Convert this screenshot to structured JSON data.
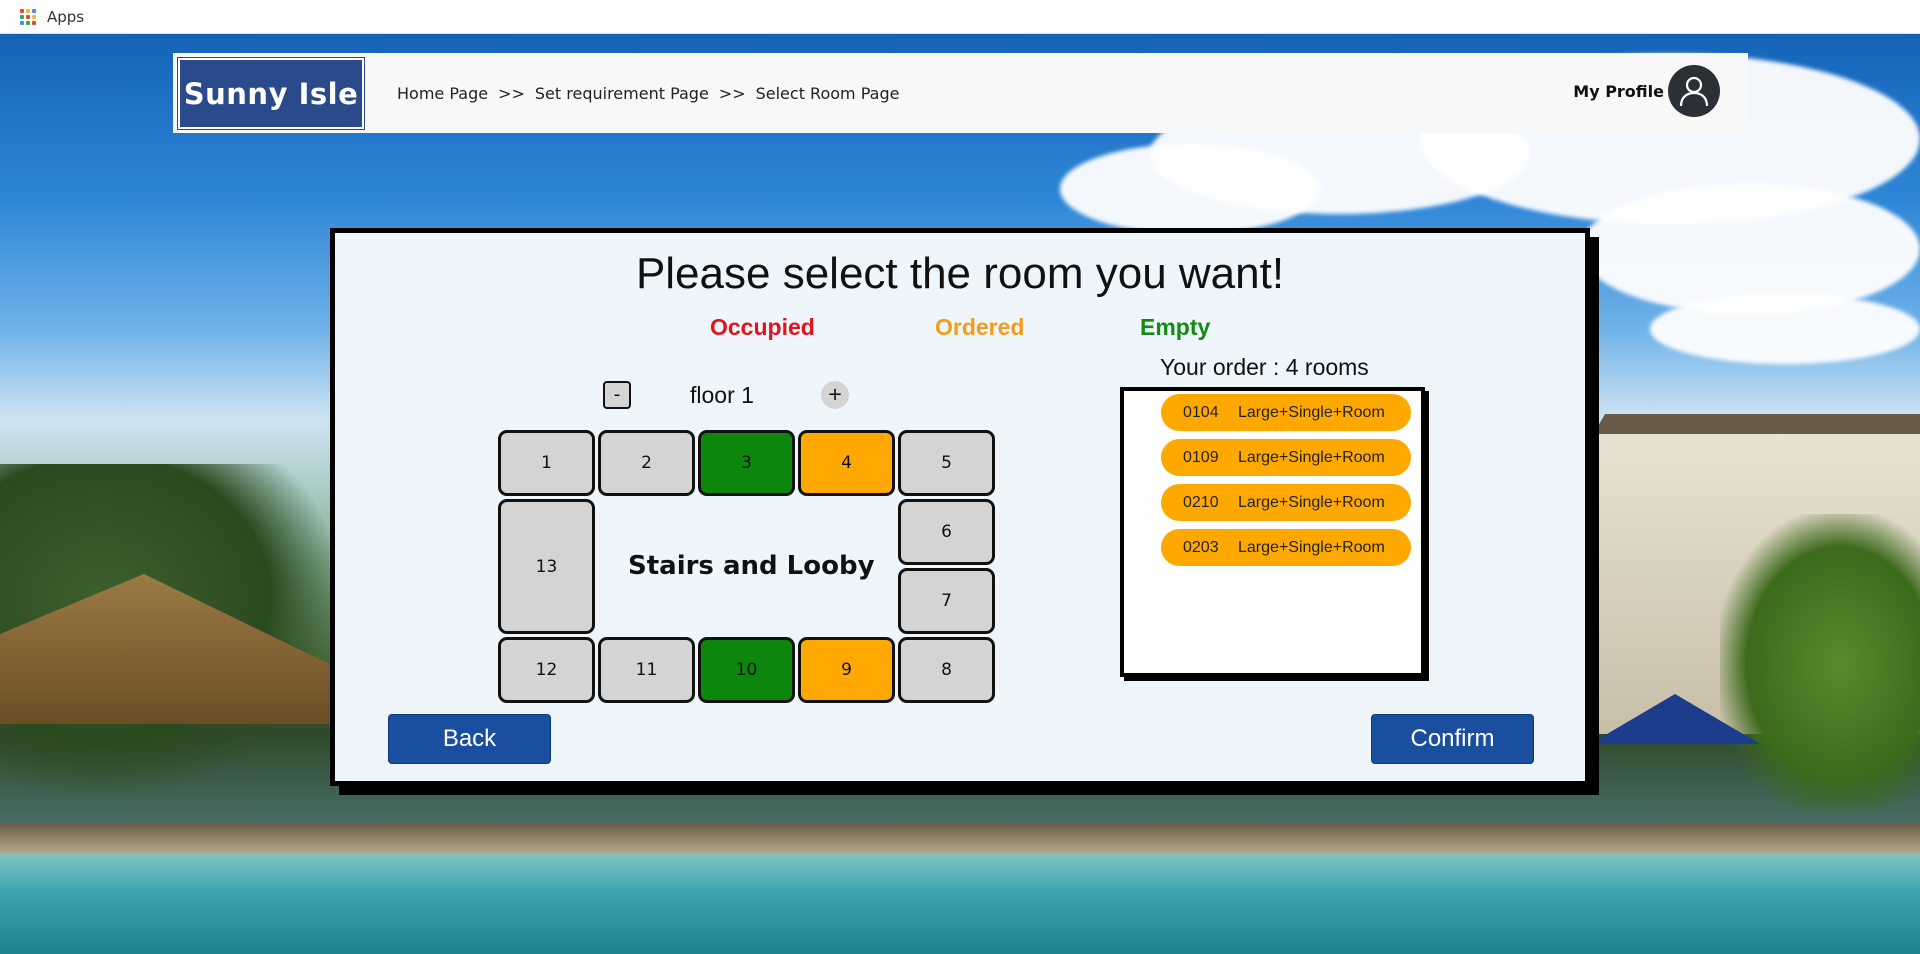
{
  "bookmarks": {
    "apps_label": "Apps",
    "apps_icon_colors": [
      "#e8453c",
      "#f9bb2d",
      "#4a8af4",
      "#3aa757",
      "#e8453c",
      "#f9bb2d",
      "#4a8af4",
      "#3aa757",
      "#e8453c"
    ]
  },
  "header": {
    "logo_text": "Sunny Isle",
    "breadcrumb": {
      "home": "Home Page",
      "sep1": ">>",
      "requirement": "Set requirement Page",
      "sep2": ">>",
      "current": "Select Room Page"
    },
    "profile_label": "My Profile",
    "profile_icon": "user-avatar-icon"
  },
  "panel": {
    "title": "Please select the room you want!",
    "legend": {
      "occupied": "Occupied",
      "ordered": "Ordered",
      "empty": "Empty"
    },
    "floor": {
      "minus_label": "-",
      "label": "floor  1",
      "plus_label": "+"
    },
    "rooms": [
      "1",
      "2",
      "3",
      "4",
      "5",
      "6",
      "7",
      "8",
      "9",
      "10",
      "11",
      "12",
      "13"
    ],
    "room_status": {
      "1": "occupied",
      "2": "occupied",
      "3": "empty",
      "4": "ordered",
      "5": "occupied",
      "6": "occupied",
      "7": "occupied",
      "8": "occupied",
      "9": "ordered",
      "10": "empty",
      "11": "occupied",
      "12": "occupied",
      "13": "occupied"
    },
    "lobby_label": "Stairs and Looby",
    "order": {
      "title": "Your order : 4 rooms",
      "items": [
        {
          "number": "0104",
          "type": "Large+Single+Room"
        },
        {
          "number": "0109",
          "type": "Large+Single+Room"
        },
        {
          "number": "0210",
          "type": "Large+Single+Room"
        },
        {
          "number": "0203",
          "type": "Large+Single+Room"
        }
      ]
    },
    "back_label": "Back",
    "confirm_label": "Confirm"
  },
  "colors": {
    "occupied": "#e0141d",
    "ordered": "#ffa800",
    "empty": "#0c860c",
    "button": "#1a4fa0",
    "logo": "#2b4a8c"
  }
}
